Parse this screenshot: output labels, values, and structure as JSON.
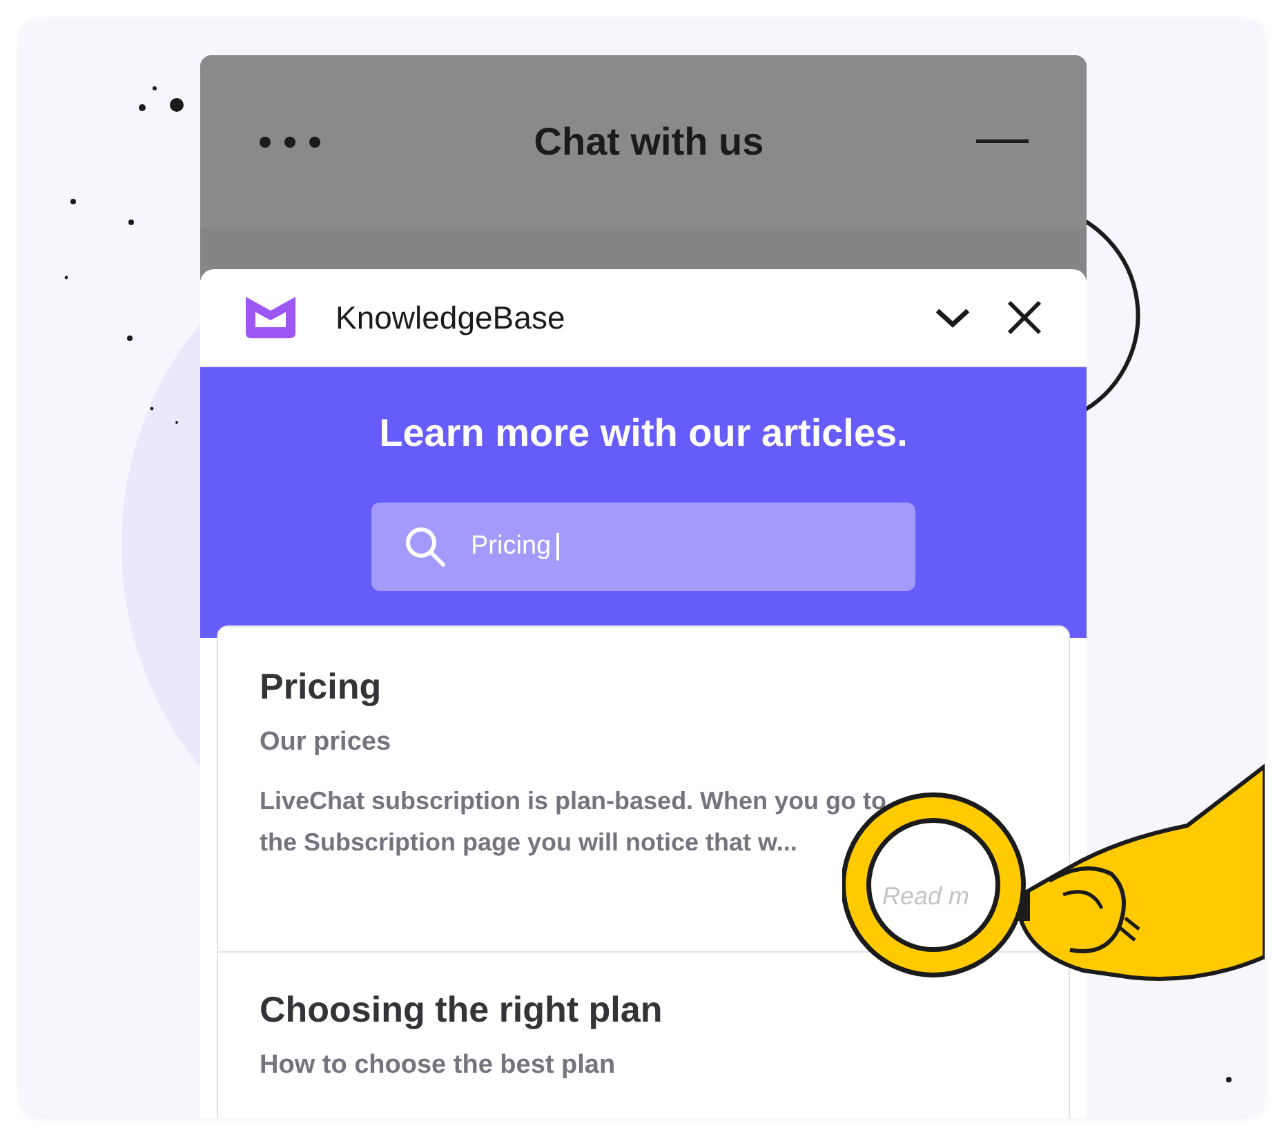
{
  "widget": {
    "title": "Chat with us"
  },
  "knowledge_base": {
    "title": "KnowledgeBase",
    "heading": "Learn more with our articles.",
    "search": {
      "value": "Pricing"
    }
  },
  "articles": [
    {
      "title": "Pricing",
      "subtitle": "Our prices",
      "excerpt": "LiveChat subscription is plan-based. When you go to the Subscription page you will notice that w...",
      "link": "Read m"
    },
    {
      "title": "Choosing the right plan",
      "subtitle": "How to choose the best plan"
    }
  ]
}
